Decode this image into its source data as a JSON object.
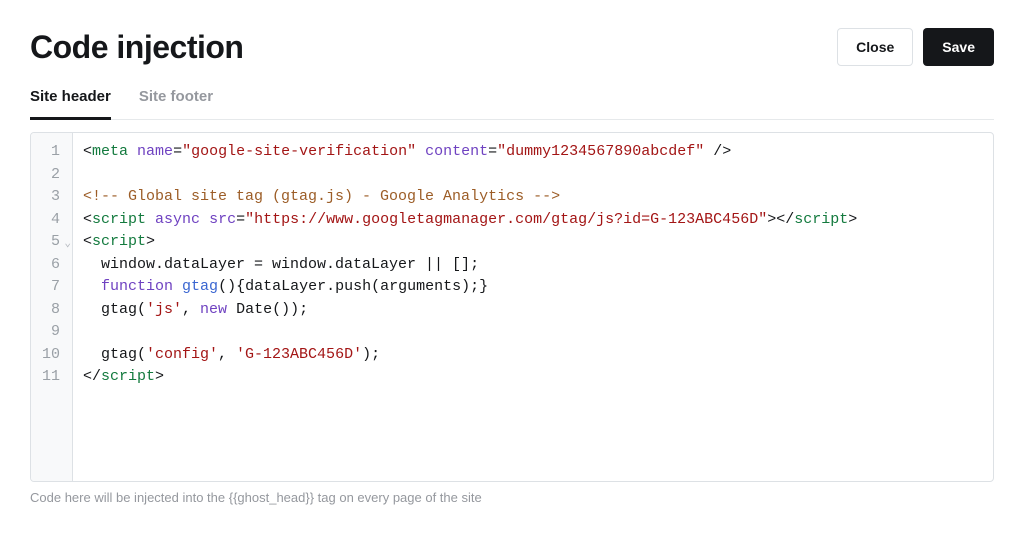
{
  "header": {
    "title": "Code injection",
    "close_label": "Close",
    "save_label": "Save"
  },
  "tabs": {
    "site_header": "Site header",
    "site_footer": "Site footer",
    "active": "site_header"
  },
  "editor": {
    "line_numbers": [
      "1",
      "2",
      "3",
      "4",
      "5",
      "6",
      "7",
      "8",
      "9",
      "10",
      "11"
    ],
    "fold_line": 5,
    "lines": [
      {
        "type": "meta",
        "name_attr": "name",
        "name_val": "google-site-verification",
        "content_attr": "content",
        "content_val": "dummy1234567890abcdef"
      },
      {
        "type": "blank"
      },
      {
        "type": "comment",
        "text": "<!-- Global site tag (gtag.js) - Google Analytics -->"
      },
      {
        "type": "script_src",
        "src": "https://www.googletagmanager.com/gtag/js?id=G-123ABC456D"
      },
      {
        "type": "script_open"
      },
      {
        "type": "js",
        "text": "  window.dataLayer = window.dataLayer || [];"
      },
      {
        "type": "js_func",
        "kw": "function",
        "fn": "gtag",
        "rest": "(){dataLayer.push(arguments);}"
      },
      {
        "type": "js_call",
        "pre": "  gtag(",
        "arg1": "'js'",
        "mid": ", ",
        "kw": "new",
        "post": " Date());"
      },
      {
        "type": "blank"
      },
      {
        "type": "js_call2",
        "pre": "  gtag(",
        "arg1": "'config'",
        "mid": ", ",
        "arg2": "'G-123ABC456D'",
        "post": ");"
      },
      {
        "type": "script_close"
      }
    ]
  },
  "helper_text": "Code here will be injected into the {{ghost_head}} tag on every page of the site"
}
